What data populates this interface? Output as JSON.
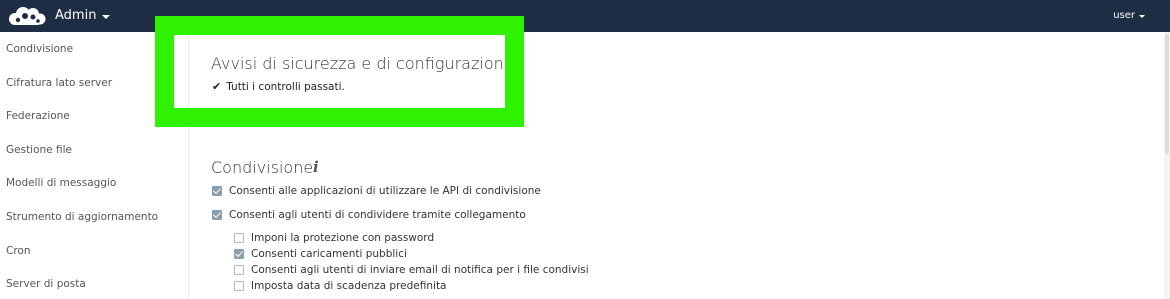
{
  "header": {
    "app_menu_label": "Admin",
    "user_menu_label": "user",
    "logo_icon": "owncloud-cloud-logo-icon"
  },
  "sidebar": {
    "items": [
      {
        "label": "Condivisione"
      },
      {
        "label": "Cifratura lato server"
      },
      {
        "label": "Federazione"
      },
      {
        "label": "Gestione file"
      },
      {
        "label": "Modelli di messaggio"
      },
      {
        "label": "Strumento di aggiornamento"
      },
      {
        "label": "Cron"
      },
      {
        "label": "Server di posta"
      }
    ]
  },
  "security": {
    "title": "Avvisi di sicurezza e di configurazione",
    "status": "Tutti i controlli passati.",
    "status_icon": "checkmark-icon"
  },
  "sharing": {
    "title": "Condivisione",
    "info_icon": "info-icon",
    "options": [
      {
        "label": "Consenti alle applicazioni di utilizzare le API di condivisione",
        "checked": true
      },
      {
        "label": "Consenti agli utenti di condividere tramite collegamento",
        "checked": true
      }
    ],
    "link_options": [
      {
        "label": "Imponi la protezione con password",
        "checked": false
      },
      {
        "label": "Consenti caricamenti pubblici",
        "checked": true
      },
      {
        "label": "Consenti agli utenti di inviare email di notifica per i file condivisi",
        "checked": false
      },
      {
        "label": "Imposta data di scadenza predefinita",
        "checked": false
      }
    ]
  },
  "colors": {
    "header_bg": "#1d2d44",
    "highlight": "#2ff200",
    "checkbox_checked": "#8a9fb0"
  }
}
